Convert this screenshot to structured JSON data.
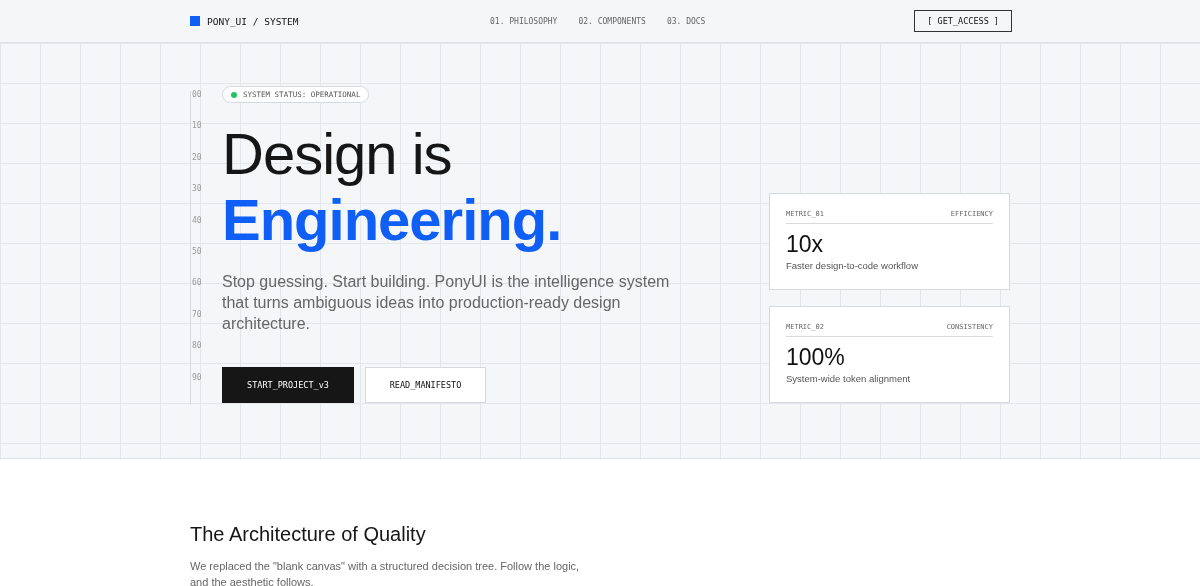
{
  "header": {
    "logo": "PONY_UI / SYSTEM",
    "nav": [
      {
        "label": "01. PHILOSOPHY"
      },
      {
        "label": "02. COMPONENTS"
      },
      {
        "label": "03. DOCS"
      }
    ],
    "cta": "[ GET_ACCESS ]"
  },
  "hero": {
    "ruler": [
      "00",
      "10",
      "20",
      "30",
      "40",
      "50",
      "60",
      "70",
      "80",
      "90"
    ],
    "status": {
      "label": "SYSTEM STATUS: OPERATIONAL",
      "color": "#22c55e"
    },
    "title_line_1": "Design is",
    "title_line_2": "Engineering.",
    "lead": "Stop guessing. Start building. PonyUI is the intelligence system that turns ambiguous ideas into production-ready design architecture.",
    "buttons": [
      {
        "label": "START_PROJECT_v3",
        "kind": "primary"
      },
      {
        "label": "READ_MANIFESTO",
        "kind": "secondary"
      }
    ],
    "metrics": [
      {
        "id_label": "METRIC_01",
        "category": "EFFICIENCY",
        "value": "10x",
        "caption": "Faster design-to-code workflow"
      },
      {
        "id_label": "METRIC_02",
        "category": "CONSISTENCY",
        "value": "100%",
        "caption": "System-wide token alignment"
      }
    ]
  },
  "section": {
    "title": "The Architecture of Quality",
    "text": "We replaced the \"blank canvas\" with a structured decision tree. Follow the logic, and the aesthetic follows."
  }
}
